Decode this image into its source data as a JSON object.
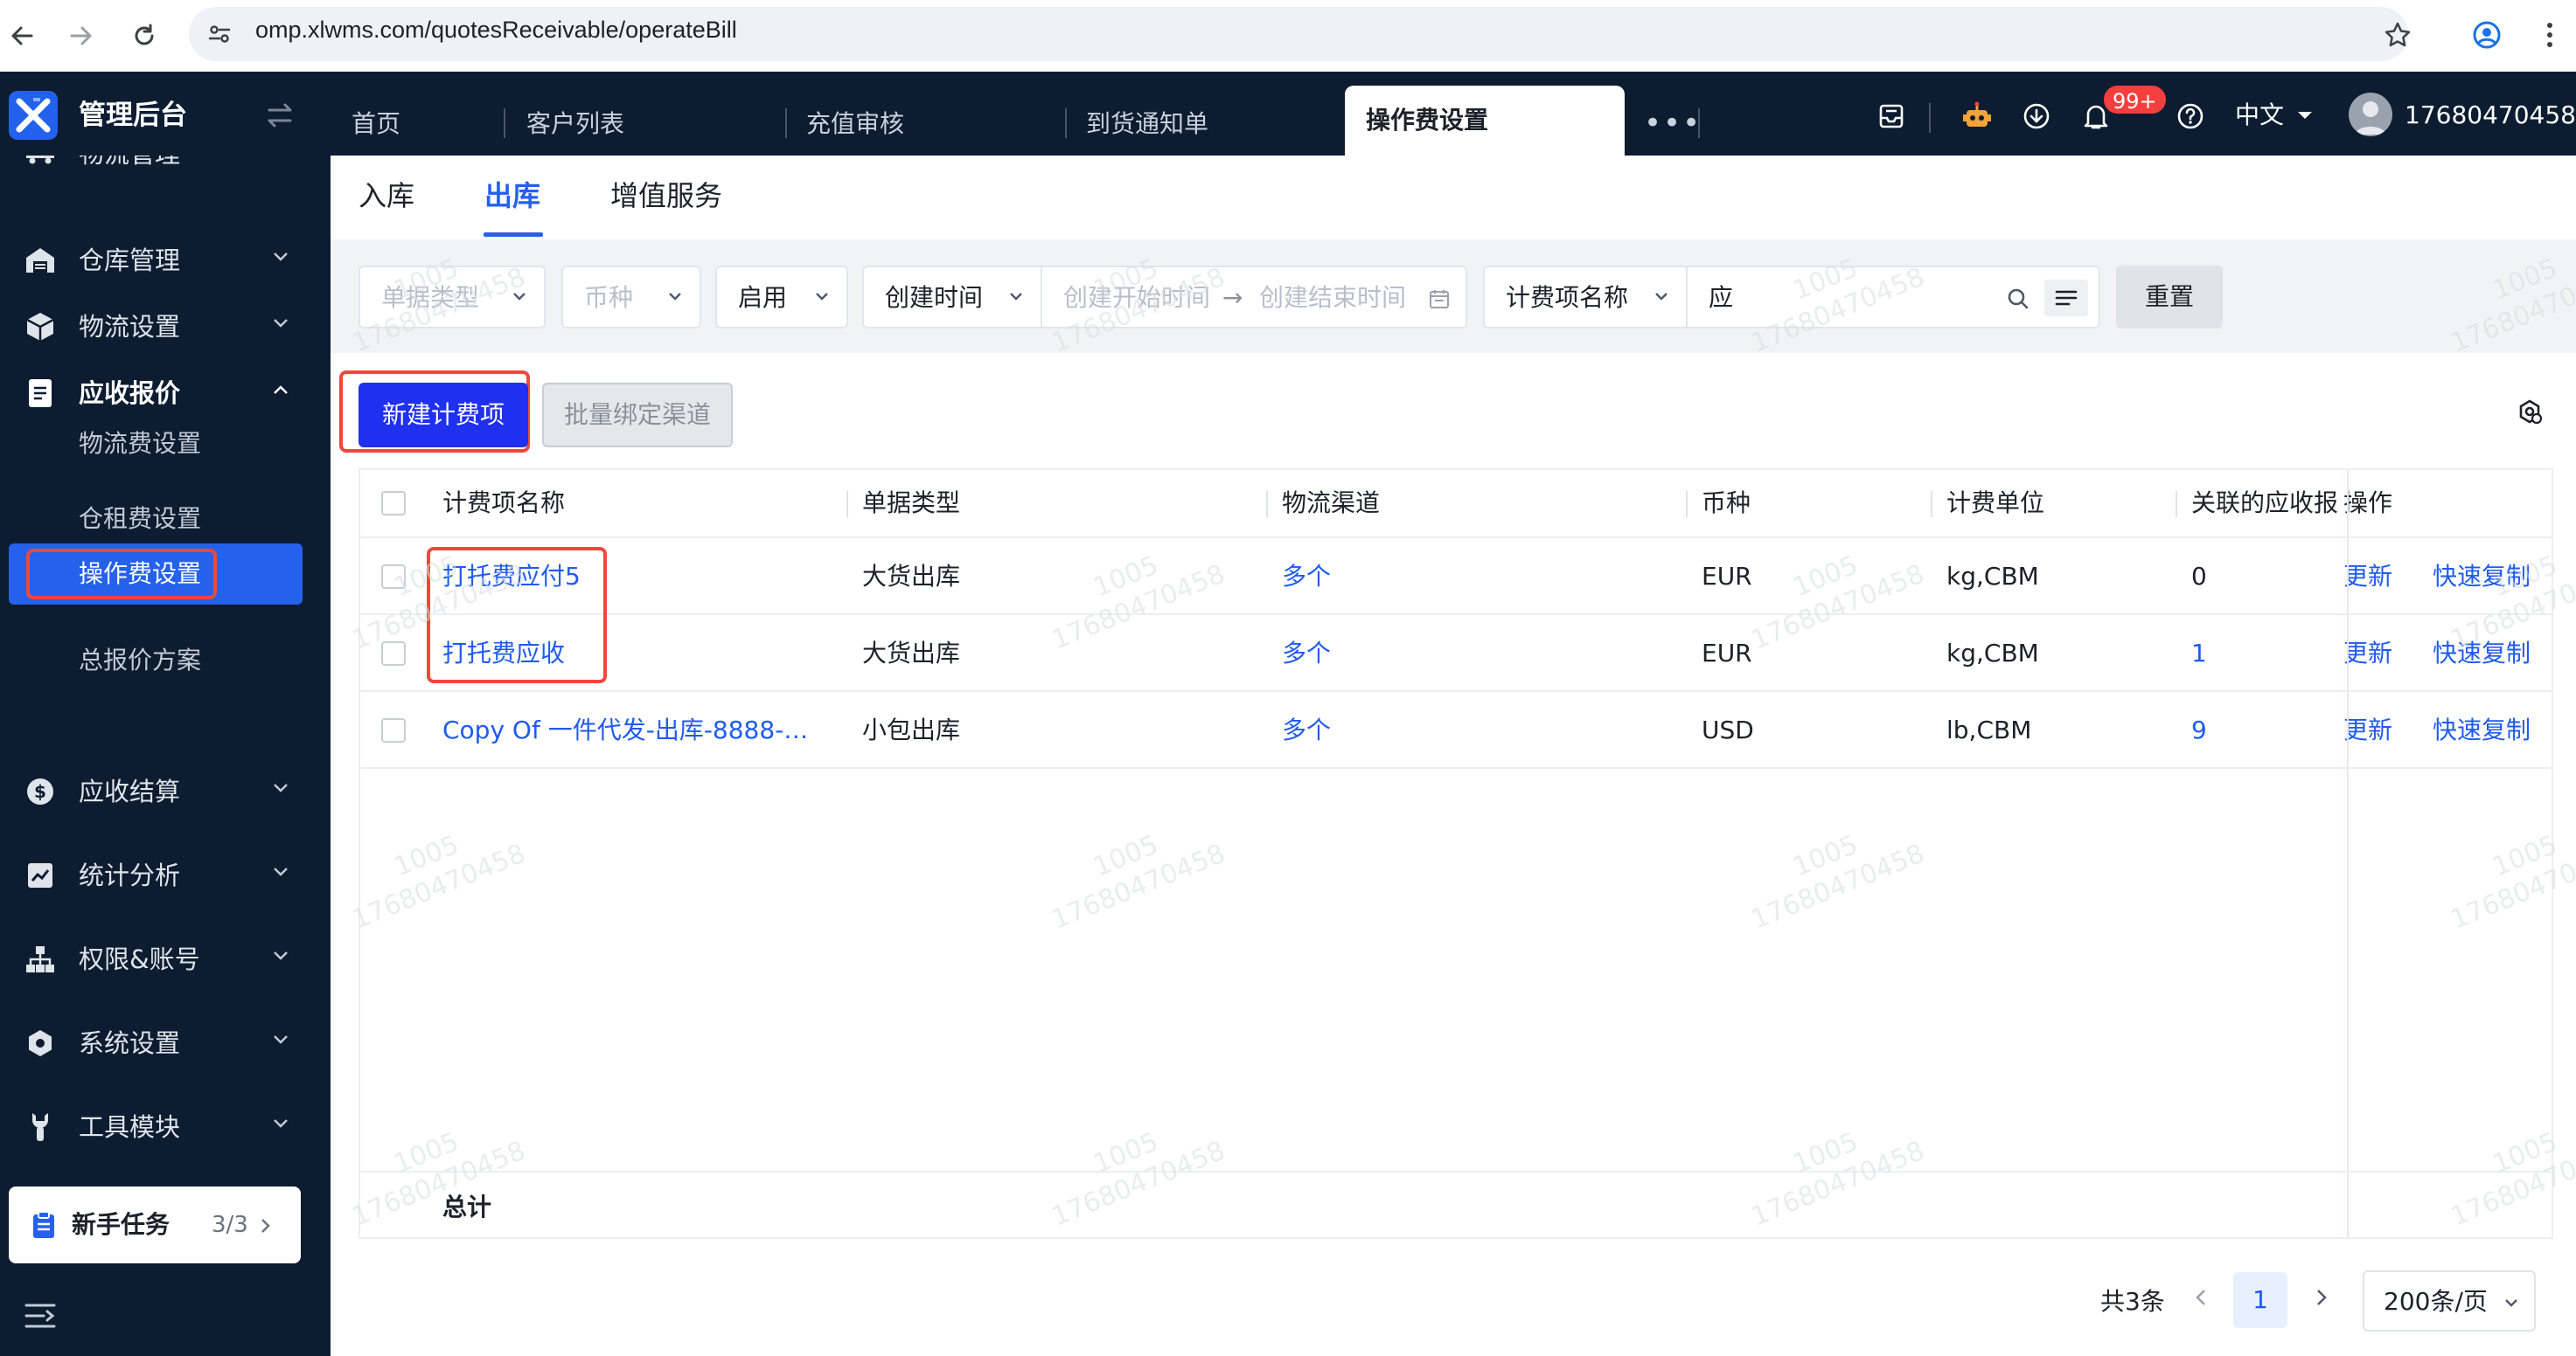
{
  "browser": {
    "url": "omp.xlwms.com/quotesReceivable/operateBill"
  },
  "topbar": {
    "app_title": "管理后台",
    "tabs": [
      "首页",
      "客户列表",
      "充值审核",
      "到货通知单"
    ],
    "active_tab": "操作费设置",
    "more": "•••",
    "notification_badge": "99+",
    "language": "中文",
    "username": "17680470458"
  },
  "sidebar": {
    "partial_item": "物流管理",
    "items": [
      {
        "label": "仓库管理",
        "icon": "warehouse-icon"
      },
      {
        "label": "物流设置",
        "icon": "cube-icon"
      },
      {
        "label": "应收报价",
        "icon": "document-icon"
      },
      {
        "label": "应收结算",
        "icon": "dollar-icon"
      },
      {
        "label": "统计分析",
        "icon": "chart-icon"
      },
      {
        "label": "权限&账号",
        "icon": "org-icon"
      },
      {
        "label": "系统设置",
        "icon": "gear-icon"
      },
      {
        "label": "工具模块",
        "icon": "wrench-icon"
      }
    ],
    "sub_items": [
      "物流费设置",
      "操作费设置",
      "仓租费设置",
      "总报价方案"
    ],
    "newbie": {
      "label": "新手任务",
      "count": "3/3"
    }
  },
  "subtabs": [
    "入库",
    "出库",
    "增值服务"
  ],
  "active_subtab": "出库",
  "filters": {
    "doc_type_placeholder": "单据类型",
    "currency_placeholder": "币种",
    "status_value": "启用",
    "time_type_value": "创建时间",
    "start_placeholder": "创建开始时间",
    "arrow": "→",
    "end_placeholder": "创建结束时间",
    "field_value": "计费项名称",
    "search_value": "应",
    "reset": "重置"
  },
  "toolbar": {
    "new_button": "新建计费项",
    "batch_button": "批量绑定渠道"
  },
  "table": {
    "columns": [
      "计费项名称",
      "单据类型",
      "物流渠道",
      "币种",
      "计费单位",
      "关联的应收报",
      "操作"
    ],
    "rows": [
      {
        "name": "打托费应付5",
        "doc_type": "大货出库",
        "channel": "多个",
        "currency": "EUR",
        "unit": "kg,CBM",
        "linked": "0",
        "linked_is_link": false
      },
      {
        "name": "打托费应收",
        "doc_type": "大货出库",
        "channel": "多个",
        "currency": "EUR",
        "unit": "kg,CBM",
        "linked": "1",
        "linked_is_link": true
      },
      {
        "name": "Copy Of 一件代发-出库-8888-…",
        "doc_type": "小包出库",
        "channel": "多个",
        "currency": "USD",
        "unit": "lb,CBM",
        "linked": "9",
        "linked_is_link": true
      }
    ],
    "actions": {
      "update": "更新",
      "copy": "快速复制"
    },
    "total_label": "总计"
  },
  "pagination": {
    "total": "共3条",
    "current": "1",
    "page_size": "200条/页"
  },
  "watermark": {
    "line1": "1005",
    "line2": "17680470458"
  },
  "colors": {
    "primary": "#2561eb",
    "nav_bg": "#0d1c30",
    "link": "#1f5bef",
    "highlight": "#f0473d"
  }
}
